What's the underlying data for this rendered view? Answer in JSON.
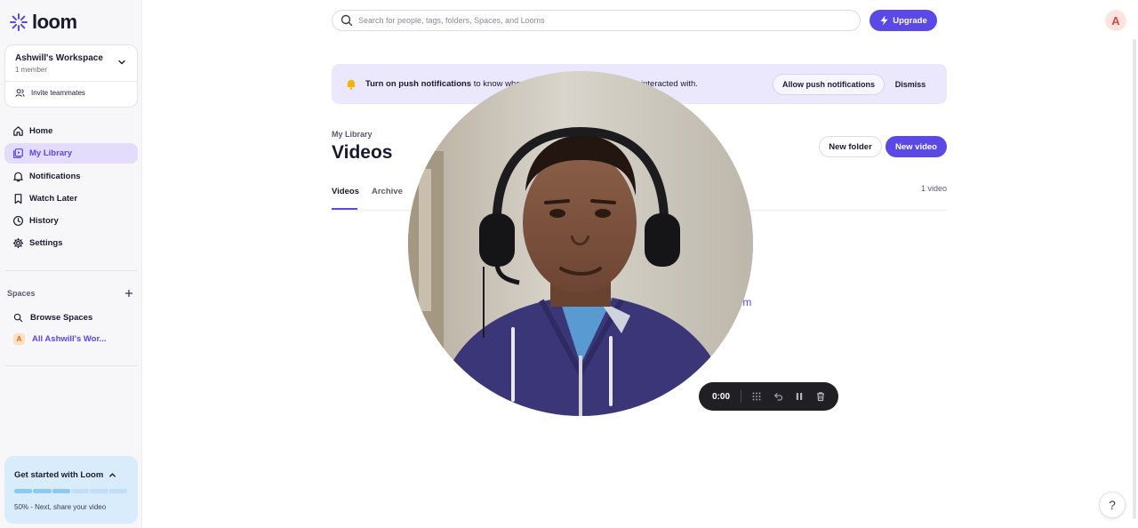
{
  "app": {
    "brand": "loom",
    "accent_color": "#5b49e6"
  },
  "workspace": {
    "name": "Ashwill's Workspace",
    "members": "1 member",
    "invite_label": "Invite teammates"
  },
  "sidebar": {
    "items": [
      {
        "label": "Home",
        "icon": "home-icon"
      },
      {
        "label": "My Library",
        "icon": "library-icon",
        "active": true
      },
      {
        "label": "Notifications",
        "icon": "bell-icon"
      },
      {
        "label": "Watch Later",
        "icon": "bookmark-icon"
      },
      {
        "label": "History",
        "icon": "clock-icon"
      },
      {
        "label": "Settings",
        "icon": "gear-icon"
      }
    ],
    "spaces_heading": "Spaces",
    "spaces": [
      {
        "label": "Browse Spaces",
        "icon": "search-icon"
      },
      {
        "label": "All Ashwill's Wor...",
        "avatar": "A"
      }
    ],
    "get_started": {
      "title": "Get started with Loom",
      "progress_percent": 50,
      "segments_done": 3,
      "segments_total": 6,
      "subtitle": "50% - Next, share your video"
    }
  },
  "header": {
    "search_placeholder": "Search for people, tags, folders, Spaces, and Looms",
    "upgrade_label": "Upgrade",
    "avatar_initial": "A"
  },
  "banner": {
    "bold": "Turn on push notifications",
    "text_start": " to know when",
    "text_end": "interacted with.",
    "allow_label": "Allow push notifications",
    "dismiss_label": "Dismiss"
  },
  "library": {
    "breadcrumb": "My Library",
    "title": "Videos",
    "new_folder_label": "New folder",
    "new_video_label": "New video",
    "tabs": [
      "Videos",
      "Archive"
    ],
    "count": "1 video",
    "partial_link": "oom"
  },
  "recorder": {
    "timer": "0:00"
  },
  "help": {
    "label": "?"
  }
}
